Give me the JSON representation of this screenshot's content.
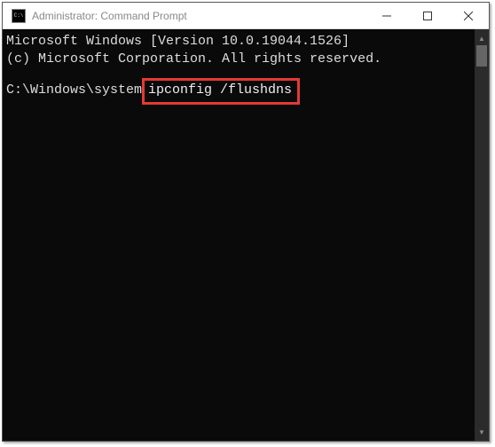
{
  "window": {
    "title": "Administrator: Command Prompt"
  },
  "terminal": {
    "line1": "Microsoft Windows [Version 10.0.19044.1526]",
    "line2": "(c) Microsoft Corporation. All rights reserved.",
    "prompt": "C:\\Windows\\system",
    "command": "ipconfig /flushdns"
  }
}
